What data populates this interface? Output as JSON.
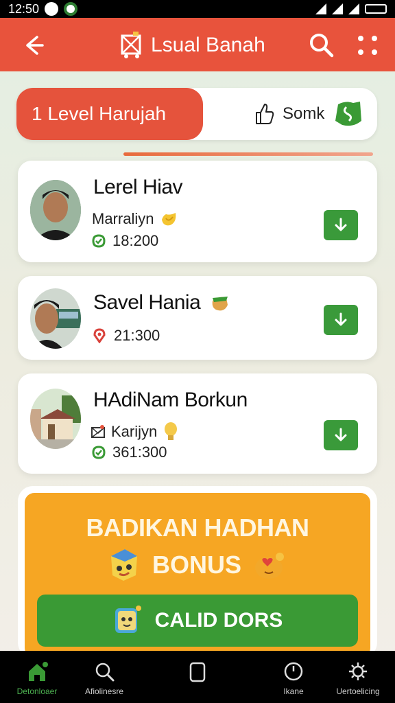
{
  "status_bar": {
    "time": "12:50"
  },
  "app_bar": {
    "title": "Lsual Banah"
  },
  "segmented": {
    "active_label": "1 Level Harujah",
    "right_label": "Somk"
  },
  "cards": [
    {
      "title": "Lerel Hiav",
      "subtitle": "Marraliyn",
      "value": "18:200"
    },
    {
      "title": "Savel Hania",
      "subtitle": "",
      "value": "21:300"
    },
    {
      "title": "HAdiNam Borkun",
      "subtitle": "Karijyn",
      "value": "361:300"
    }
  ],
  "bonus": {
    "line1": "BADIKAN HADHAN",
    "line2": "BONUS",
    "button_label": "CALID DORS"
  },
  "bottom_nav": [
    {
      "label": "Detonloaer",
      "icon": "home-icon",
      "active": true
    },
    {
      "label": "Afiolinesre",
      "icon": "search-icon",
      "active": false
    },
    {
      "label": "",
      "icon": "square-icon",
      "active": false
    },
    {
      "label": "Ikane",
      "icon": "gauge-icon",
      "active": false
    },
    {
      "label": "Uertoelicing",
      "icon": "gear-icon",
      "active": false
    }
  ],
  "colors": {
    "primary": "#e8533c",
    "green": "#3a9a35",
    "bonus": "#f6a623"
  }
}
